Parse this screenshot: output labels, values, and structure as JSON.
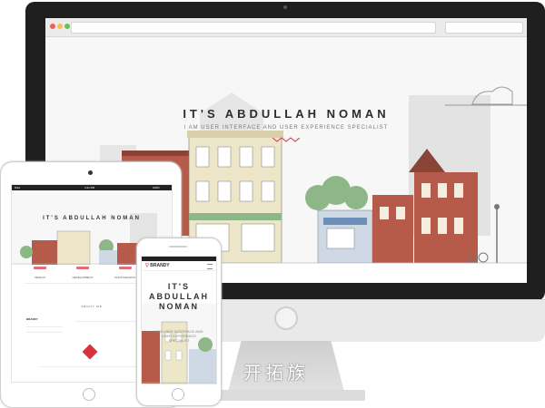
{
  "desktop": {
    "hero_title": "IT'S ABDULLAH NOMAN",
    "hero_subtitle": "I AM USER INTERFACE AND USER EXPERIENCE SPECIALIST"
  },
  "tablet": {
    "status_left": "iPad",
    "status_time": "4:21 PM",
    "status_right": "100%",
    "hero_title": "IT'S ABDULLAH NOMAN",
    "features": [
      "DESIGN",
      "DEVELOPMENT",
      "PHOTOGRAPHY"
    ],
    "about_label": "ABOUT ME",
    "brand": "BRANDY"
  },
  "phone": {
    "status_time": "4:21 PM",
    "brand": "BRANDY",
    "hero_title": "IT'S ABDULLAH NOMAN",
    "hero_subtitle": "I AM USER INTERFACE AND USER EXPERIENCE SPECIALIST"
  },
  "watermark": "开拓族",
  "colors": {
    "accent": "#d8323f",
    "bezel": "#1f1f1f",
    "brick": "#b65a4a",
    "cream": "#eee6c8",
    "green": "#8db786",
    "skyline": "#dcdcdc"
  },
  "icons": [
    "apple-logo-icon",
    "home-button-icon",
    "menu-icon",
    "browser-back-icon",
    "browser-forward-icon"
  ]
}
